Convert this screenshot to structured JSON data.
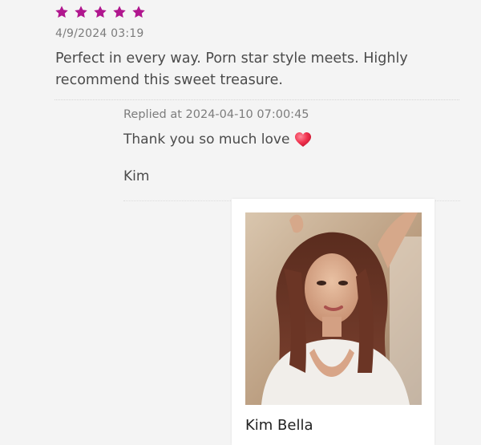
{
  "review": {
    "rating": 5,
    "star_color": "#b0168e",
    "date": "4/9/2024 03:19",
    "text": "Perfect in every way. Porn star style meets. Highly recommend this sweet treasure."
  },
  "reply": {
    "date": "Replied at 2024-04-10 07:00:45",
    "text": "Thank you so much love",
    "emoji_icon": "red-heart-icon",
    "signoff": "Kim"
  },
  "profile_card": {
    "name": "Kim Bella",
    "photo_icon": "profile-photo"
  }
}
